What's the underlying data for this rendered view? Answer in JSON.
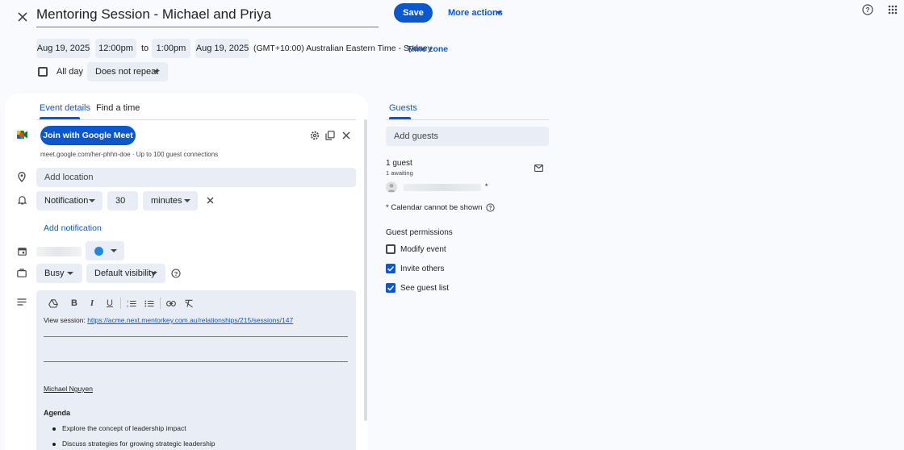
{
  "event": {
    "title": "Mentoring Session - Michael and Priya",
    "save_label": "Save",
    "more_actions_label": "More actions"
  },
  "datetime": {
    "start_date": "Aug 19, 2025",
    "start_time": "12:00pm",
    "to_label": "to",
    "end_time": "1:00pm",
    "end_date": "Aug 19, 2025",
    "timezone_text": "(GMT+10:00) Australian Eastern Time - Sydney",
    "timezone_link": "Time zone",
    "all_day_label": "All day",
    "all_day_checked": false,
    "repeat_value": "Does not repeat"
  },
  "tabs": {
    "event_details": "Event details",
    "find_a_time": "Find a time",
    "guests": "Guests"
  },
  "meet": {
    "join_label": "Join with Google Meet",
    "info": "meet.google.com/her-phhn-doe · Up to 100 guest connections"
  },
  "location": {
    "placeholder": "Add location"
  },
  "notification": {
    "type": "Notification",
    "amount": "30",
    "unit": "minutes",
    "add_label": "Add notification"
  },
  "calendar": {
    "color": "#1e88e5"
  },
  "availability": {
    "status": "Busy",
    "visibility": "Default visibility"
  },
  "description": {
    "view_session_label": "View session:",
    "session_url": "https://acme.next.mentorkey.com.au/relationships/215/sessions/147",
    "mentor_name": "Michael Nguyen",
    "agenda_heading": "Agenda",
    "agenda_items": [
      "Explore the concept of leadership impact",
      "Discuss strategies for growing strategic leadership"
    ]
  },
  "guests": {
    "add_placeholder": "Add guests",
    "count_label": "1 guest",
    "awaiting_label": "1 awaiting",
    "note": "* Calendar cannot be shown",
    "permissions_title": "Guest permissions",
    "permissions": [
      {
        "label": "Modify event",
        "checked": false
      },
      {
        "label": "Invite others",
        "checked": true
      },
      {
        "label": "See guest list",
        "checked": true
      }
    ]
  },
  "colors": {
    "accent": "#0b57d0",
    "field_bg": "#e9eef6",
    "page_bg": "#f8fafd"
  }
}
